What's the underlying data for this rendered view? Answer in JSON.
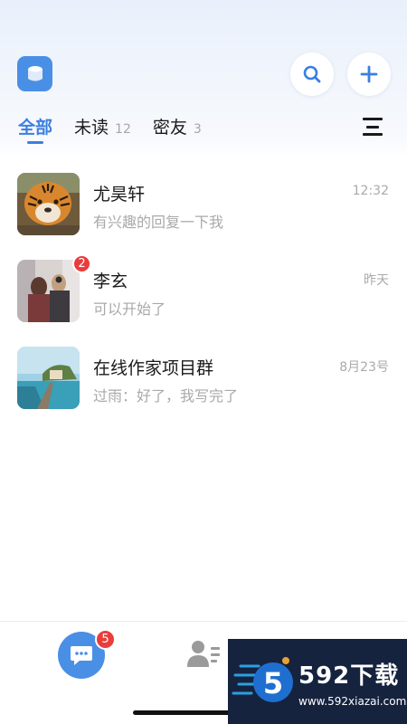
{
  "header": {
    "logo_icon": "app-box-icon",
    "search_icon": "search-icon",
    "add_icon": "plus-icon",
    "accent_color": "#4a8fe6"
  },
  "tabs": [
    {
      "label": "全部",
      "count": "",
      "active": true
    },
    {
      "label": "未读",
      "count": "12",
      "active": false
    },
    {
      "label": "密友",
      "count": "3",
      "active": false
    }
  ],
  "menu_icon": "menu-icon",
  "chats": [
    {
      "name": "尤昊轩",
      "message": "有兴趣的回复一下我",
      "time": "12:32",
      "unread": "",
      "avatar": "tiger-photo"
    },
    {
      "name": "李玄",
      "message": "可以开始了",
      "time": "昨天",
      "unread": "2",
      "avatar": "women-photo"
    },
    {
      "name": "在线作家项目群",
      "message": "过雨：好了，我写完了",
      "time": "8月23号",
      "unread": "",
      "avatar": "seaside-photo"
    }
  ],
  "bottom_nav": {
    "chat_icon": "chat-bubble-icon",
    "chat_badge": "5",
    "contacts_icon": "contacts-icon"
  },
  "watermark": {
    "text": "592下载",
    "url": "www.592xiazai.com"
  }
}
